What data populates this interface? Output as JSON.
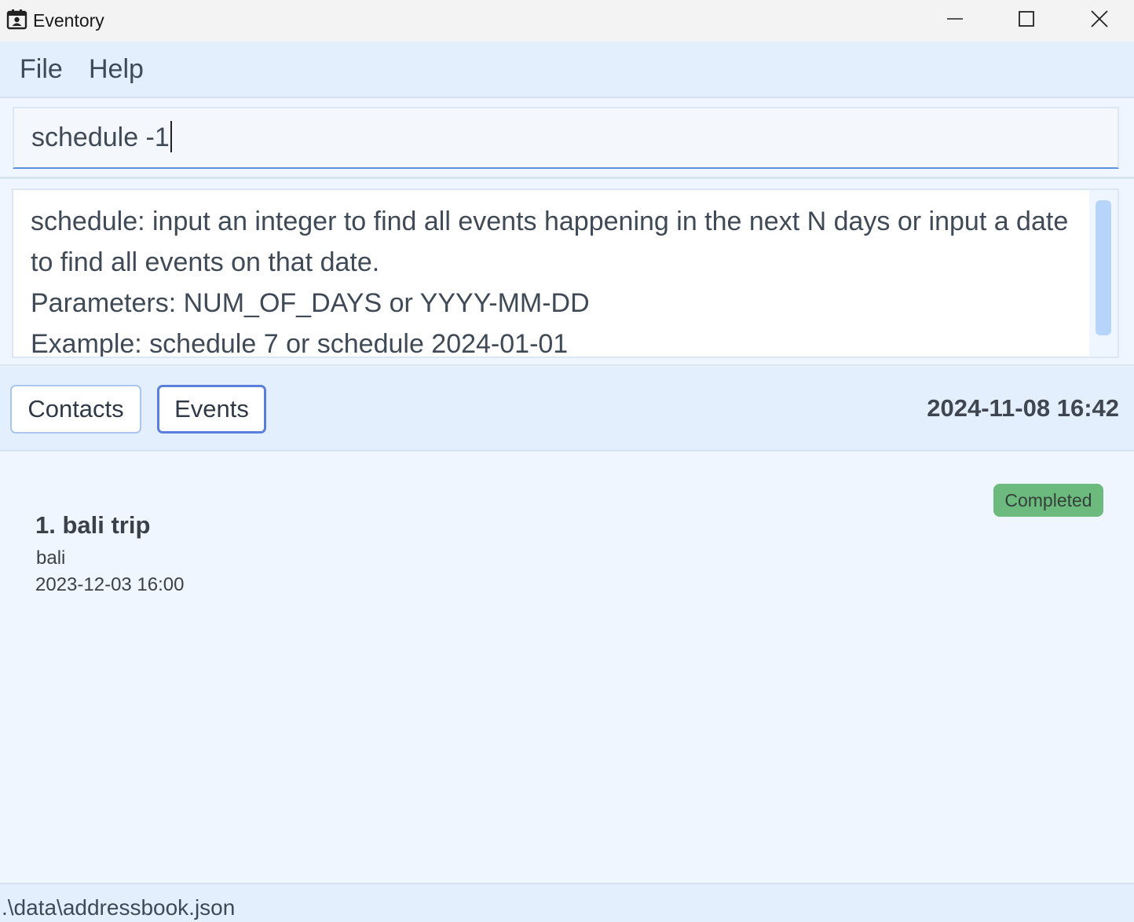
{
  "window": {
    "title": "Eventory",
    "icon": "calendar-contact-icon",
    "controls": [
      "minimize-icon",
      "maximize-icon",
      "close-icon"
    ]
  },
  "menubar": {
    "file_label": "File",
    "help_label": "Help"
  },
  "command": {
    "value": "schedule -1"
  },
  "result": {
    "lines": [
      "schedule: input an integer to find all events happening in the next N days or input a date to find all events on that date.",
      "Parameters: NUM_OF_DAYS or YYYY-MM-DD",
      "Example: schedule 7 or schedule 2024-01-01"
    ]
  },
  "tabs": {
    "contacts_label": "Contacts",
    "events_label": "Events",
    "active": "Events"
  },
  "clock": "2024-11-08 16:42",
  "events": [
    {
      "title": "1. bali trip",
      "location": "bali",
      "datetime": "2023-12-03 16:00",
      "status": "Completed"
    }
  ],
  "statusbar": {
    "path": ".\\data\\addressbook.json"
  },
  "colors": {
    "accent": "#5a7fdb",
    "completed_badge": "#6dba7f",
    "panel_bg": "#e3effd",
    "page_bg": "#eff6ff",
    "scroll_thumb": "#b7d5fb"
  }
}
